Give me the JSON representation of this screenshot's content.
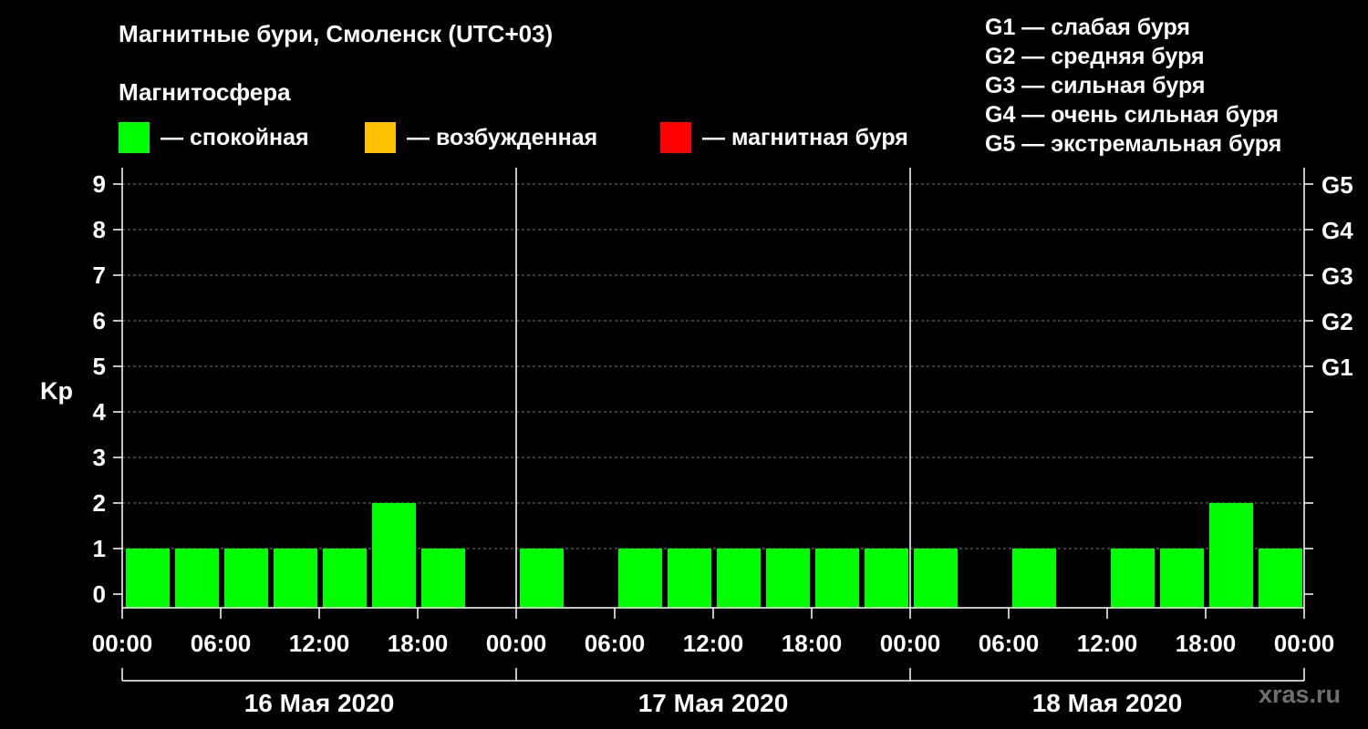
{
  "title": "Магнитные бури, Смоленск (UTC+03)",
  "subtitle": "Магнитосфера",
  "legend": [
    {
      "color": "#00ff00",
      "label": "— спокойная"
    },
    {
      "color": "#ffc000",
      "label": "— возбужденная"
    },
    {
      "color": "#ff0000",
      "label": "— магнитная буря"
    }
  ],
  "storm_legend": [
    "G1 — слабая буря",
    "G2 — средняя буря",
    "G3 — сильная буря",
    "G4 — очень сильная буря",
    "G5 — экстремальная буря"
  ],
  "site": "xras.ru",
  "chart_data": {
    "type": "bar",
    "ylabel": "Kp",
    "ylim": [
      0,
      9
    ],
    "yticks": [
      "0",
      "1",
      "2",
      "3",
      "4",
      "5",
      "6",
      "7",
      "8",
      "9"
    ],
    "right_ticks": [
      {
        "kp": 5,
        "label": "G1"
      },
      {
        "kp": 6,
        "label": "G2"
      },
      {
        "kp": 7,
        "label": "G3"
      },
      {
        "kp": 8,
        "label": "G4"
      },
      {
        "kp": 9,
        "label": "G5"
      }
    ],
    "grid": true,
    "x_tick_labels": [
      "00:00",
      "06:00",
      "12:00",
      "18:00",
      "00:00",
      "06:00",
      "12:00",
      "18:00",
      "00:00",
      "06:00",
      "12:00",
      "18:00",
      "00:00"
    ],
    "days": [
      "16 Мая 2020",
      "17 Мая 2020",
      "18 Мая 2020"
    ],
    "interval_hours": 3,
    "values": [
      1,
      1,
      1,
      1,
      1,
      2,
      1,
      0,
      1,
      0,
      1,
      1,
      1,
      1,
      1,
      1,
      1,
      0,
      1,
      0,
      1,
      1,
      2,
      1
    ],
    "bar_color": "#00ff00"
  }
}
